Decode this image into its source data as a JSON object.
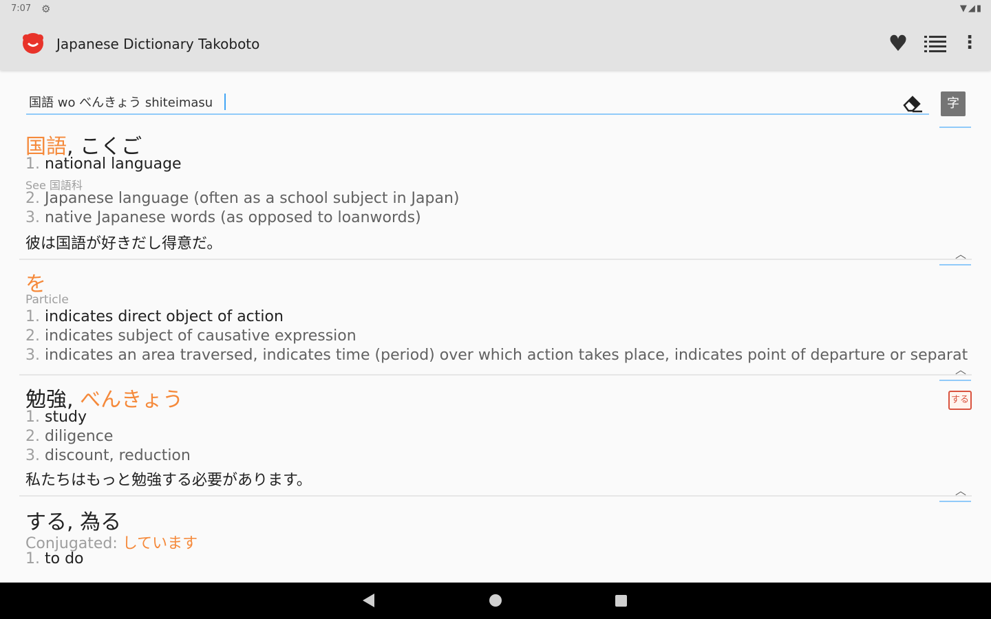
{
  "status": {
    "time": "7:07"
  },
  "app": {
    "title": "Japanese Dictionary Takoboto"
  },
  "search": {
    "value": "国語 wo べんきょう shiteimasu"
  },
  "kanji_button": "字",
  "entries": [
    {
      "kanji": "国語",
      "separator": ", ",
      "reading": "こくご",
      "defs": [
        {
          "num": "1.",
          "text": "national language"
        },
        {
          "num": "2.",
          "text": "Japanese language (often as a school subject in Japan)"
        },
        {
          "num": "3.",
          "text": "native Japanese words (as opposed to loanwords)"
        }
      ],
      "see": "See 国語科",
      "example": "彼は国語が好きだし得意だ。"
    },
    {
      "kana": "を",
      "pos": "Particle",
      "defs": [
        {
          "num": "1.",
          "text": "indicates direct object of action"
        },
        {
          "num": "2.",
          "text": "indicates subject of causative expression"
        },
        {
          "num": "3.",
          "text": "indicates an area traversed, indicates time (period) over which action takes place, indicates point of departure or separatio..."
        }
      ]
    },
    {
      "kanji": "勉強",
      "separator": ", ",
      "reading": "べんきょう",
      "defs": [
        {
          "num": "1.",
          "text": "study"
        },
        {
          "num": "2.",
          "text": "diligence"
        },
        {
          "num": "3.",
          "text": "discount, reduction"
        }
      ],
      "badge": "する",
      "example": "私たちはもっと勉強する必要があります。"
    },
    {
      "headword": "する, 為る",
      "conj_label": "Conjugated: ",
      "conj_value": "しています",
      "defs": [
        {
          "num": "1.",
          "text": "to do"
        }
      ]
    }
  ],
  "colors": {
    "accent": "#f5893a",
    "underline": "#90caf9",
    "appbar": "#e3e3e3"
  },
  "icons": [
    "settings-icon",
    "wifi-icon",
    "signal-icon",
    "battery-icon",
    "logo",
    "heart-icon",
    "list-icon",
    "more-icon",
    "eraser-icon",
    "chevron-up-icon",
    "back-icon",
    "home-icon",
    "recents-icon"
  ]
}
